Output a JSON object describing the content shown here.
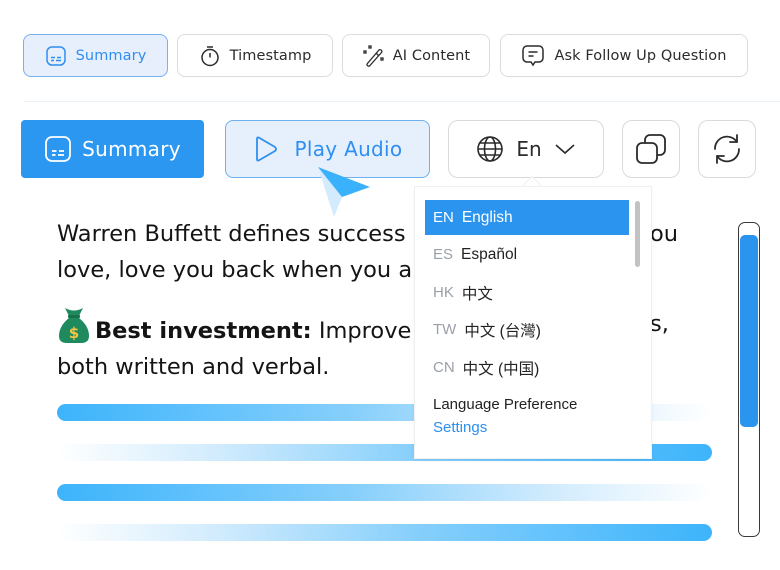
{
  "top_tabs": [
    {
      "label": "Summary",
      "icon": "subtitles-icon",
      "active": true
    },
    {
      "label": "Timestamp",
      "icon": "stopwatch-icon",
      "active": false
    },
    {
      "label": "AI Content",
      "icon": "magic-wand-icon",
      "active": false
    },
    {
      "label": "Ask Follow Up Question",
      "icon": "chat-bubble-icon",
      "active": false
    }
  ],
  "toolbar": {
    "summary_label": "Summary",
    "play_audio_label": "Play Audio",
    "language_label": "En",
    "copy_icon": "copy-icon",
    "refresh_icon": "refresh-icon"
  },
  "content": {
    "para1_line1": "Warren Buffett defines success",
    "para1_line1_tail": "ou",
    "para1_line2": "love, love you back when you a",
    "para2_bold": "Best investment:",
    "para2_text": " Improve",
    "para2_tail": "s,",
    "para2_line2": "both written and verbal.",
    "emoji": "money-bag-icon"
  },
  "dropdown": {
    "items": [
      {
        "code": "EN",
        "name": "English",
        "selected": true
      },
      {
        "code": "ES",
        "name": "Español",
        "selected": false
      },
      {
        "code": "HK",
        "name": "中文",
        "selected": false
      },
      {
        "code": "TW",
        "name": "中文 (台灣)",
        "selected": false
      },
      {
        "code": "CN",
        "name": "中文 (中国)",
        "selected": false
      }
    ],
    "preference_label": "Language Preference",
    "settings_link": "Settings"
  },
  "scroll": {
    "position_fraction": 0.03,
    "visible_fraction": 0.62
  },
  "colors": {
    "accent": "#2b94ef",
    "accent_light": "#e6effc",
    "bar_gradient": "#3db4fb"
  }
}
